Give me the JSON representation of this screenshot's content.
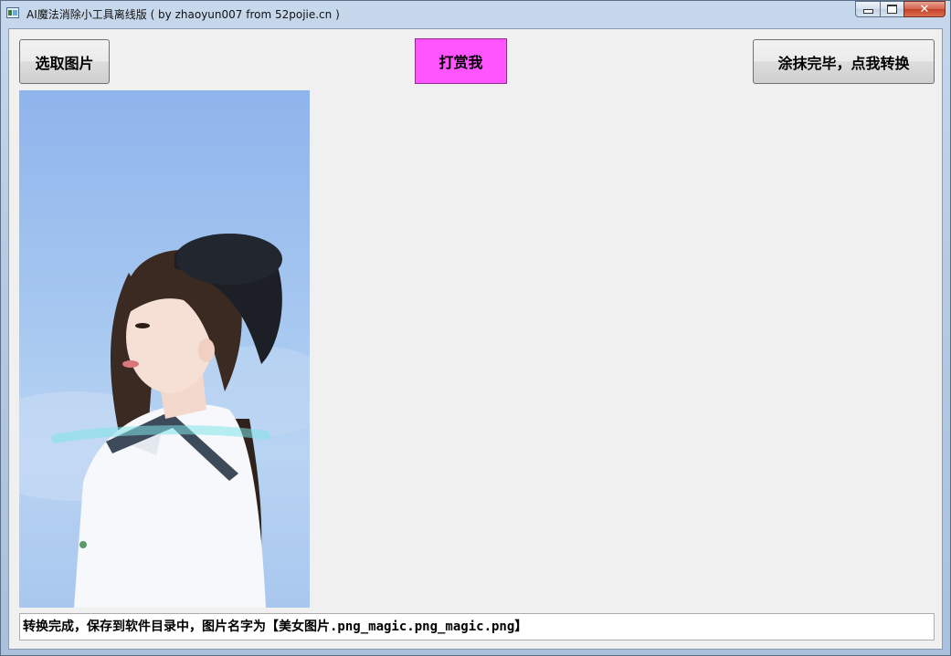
{
  "window": {
    "title": "AI魔法消除小工具离线版 ( by zhaoyun007 from 52pojie.cn )",
    "close_glyph": "✕"
  },
  "toolbar": {
    "select_image_label": "选取图片",
    "reward_label": "打赏我",
    "convert_label": "涂抹完毕，点我转换"
  },
  "colors": {
    "reward_button_bg": "#ff55ff",
    "client_bg": "#f0f0f0"
  },
  "canvas": {
    "image_description_icon": "photo-girl-in-black-beret"
  },
  "status": {
    "message": "转换完成，保存到软件目录中，图片名字为【美女图片.png_magic.png_magic.png】"
  }
}
